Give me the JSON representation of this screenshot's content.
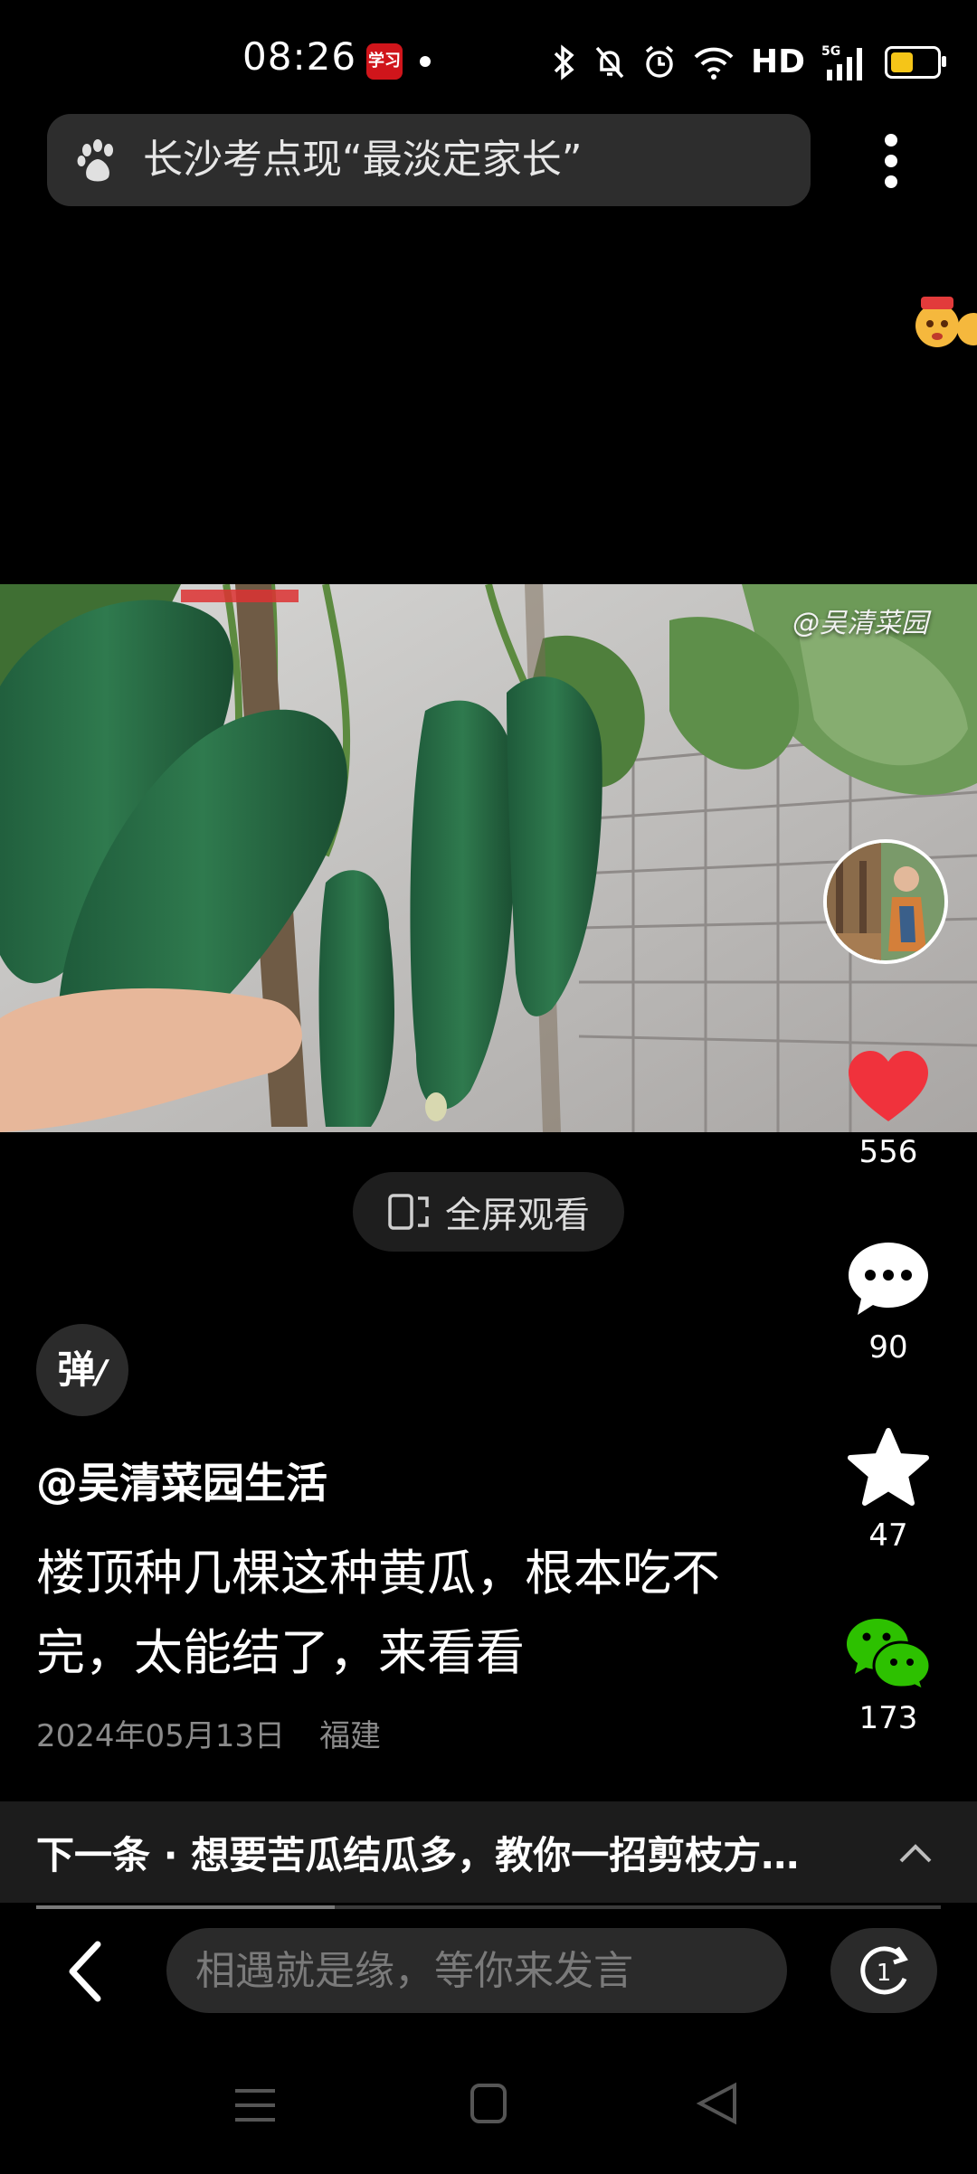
{
  "status_bar": {
    "time": "08:26",
    "app_badge": "学习",
    "network": "HD",
    "network_gen": "5G",
    "battery_level": 0.55
  },
  "search": {
    "query": "长沙考点现“最淡定家长”"
  },
  "video": {
    "watermark": "@吴清菜园"
  },
  "actions": {
    "likes": "556",
    "comments": "90",
    "favorites": "47",
    "shares": "173"
  },
  "fullscreen_label": "全屏观看",
  "danmaku_label": "弹",
  "post": {
    "author": "@吴清菜园生活",
    "title": "楼顶种几棵这种黄瓜，根本吃不完，太能结了，来看看",
    "date": "2024年05月13日",
    "location": "福建"
  },
  "next_up": {
    "text": "下一条 · 想要苦瓜结瓜多，教你一招剪枝方…",
    "progress": 0.33
  },
  "comment_input": {
    "placeholder": "相遇就是缘，等你来发言"
  },
  "colors": {
    "like": "#f0323c",
    "share": "#2dc100",
    "accent_badge": "#d0151b"
  }
}
